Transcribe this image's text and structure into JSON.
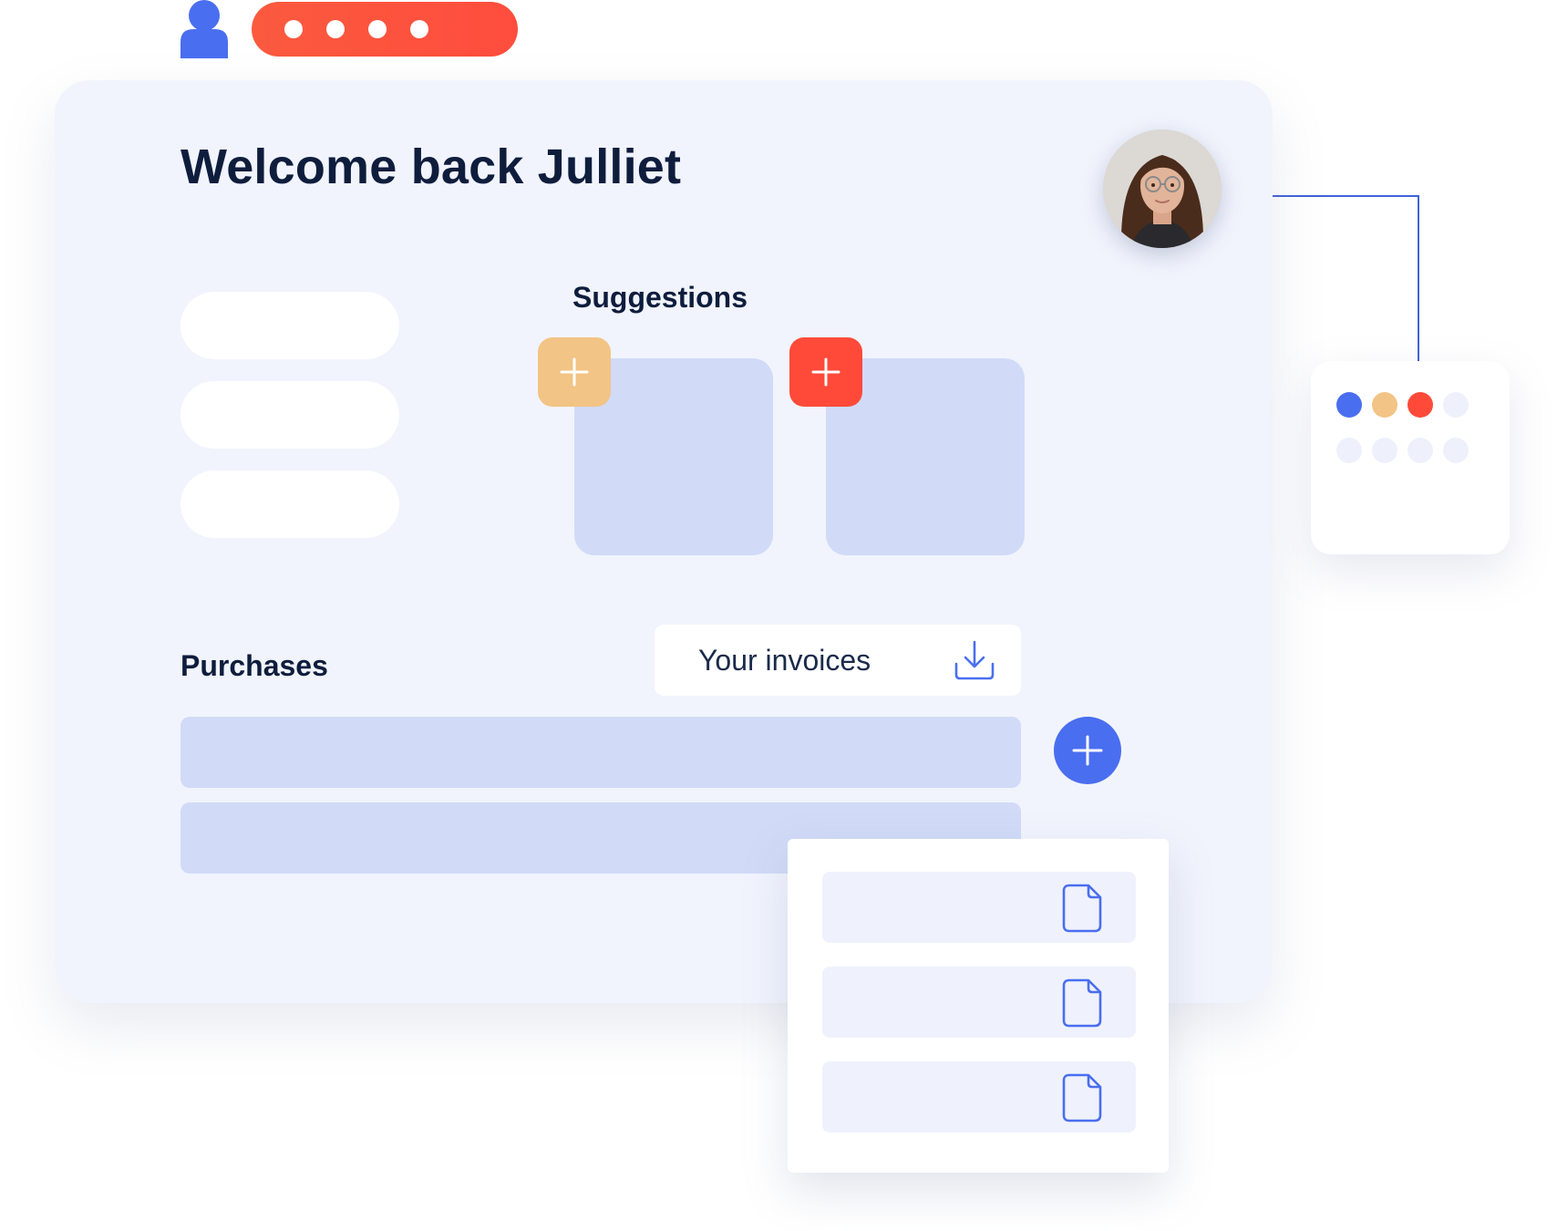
{
  "header": {
    "password_mask_dots": 4
  },
  "dashboard": {
    "welcome_title": "Welcome back Julliet",
    "suggestions_heading": "Suggestions",
    "purchases_heading": "Purchases",
    "invoices_button_label": "Your invoices"
  },
  "colors": {
    "accent_blue": "#4a6ef0",
    "accent_orange": "#f2c485",
    "accent_red": "#ff4a3a",
    "card_bg": "#f1f4fd",
    "placeholder_blue": "#d1dbf7"
  },
  "color_picker": {
    "swatches": [
      "#4a6ef0",
      "#f2c485",
      "#ff4a3a",
      "#eef1fc",
      "#eef1fc",
      "#eef1fc",
      "#eef1fc",
      "#eef1fc"
    ]
  },
  "icons": {
    "user": "user-icon",
    "add": "plus-icon",
    "download": "download-icon",
    "document": "document-icon"
  }
}
